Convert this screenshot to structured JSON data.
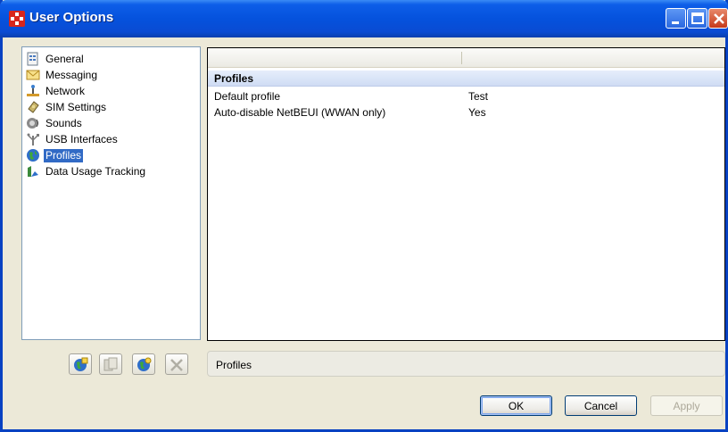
{
  "window": {
    "title": "User Options",
    "controls": [
      "minimize-icon",
      "maximize-icon",
      "close-icon"
    ]
  },
  "tree": {
    "items": [
      {
        "label": "General",
        "icon": "general-settings-icon"
      },
      {
        "label": "Messaging",
        "icon": "envelope-icon"
      },
      {
        "label": "Network",
        "icon": "network-icon"
      },
      {
        "label": "SIM Settings",
        "icon": "sim-card-icon"
      },
      {
        "label": "Sounds",
        "icon": "speaker-icon"
      },
      {
        "label": "USB Interfaces",
        "icon": "usb-icon"
      },
      {
        "label": "Profiles",
        "icon": "globe-icon",
        "selected": true
      },
      {
        "label": "Data Usage Tracking",
        "icon": "data-usage-icon"
      }
    ]
  },
  "properties": {
    "group": "Profiles",
    "rows": [
      {
        "name": "Default profile",
        "value": "Test"
      },
      {
        "name": "Auto-disable NetBEUI (WWAN only)",
        "value": "Yes"
      }
    ]
  },
  "toolbar": {
    "buttons": [
      "new-profile-icon",
      "copy-profile-icon",
      "import-profile-icon",
      "delete-icon"
    ]
  },
  "description": "Profiles",
  "buttons": {
    "ok": "OK",
    "cancel": "Cancel",
    "apply": "Apply"
  },
  "colors": {
    "selection": "#316ac5",
    "titlebar": "#0552dd",
    "group_header": "#cfdcf4"
  }
}
